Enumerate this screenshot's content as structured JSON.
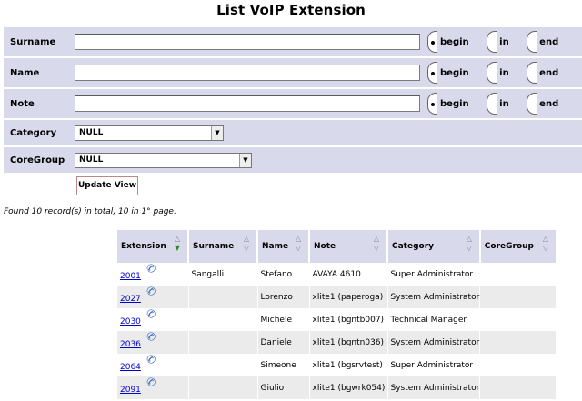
{
  "page": {
    "title": "List VoIP Extension"
  },
  "filters": {
    "surname": {
      "label": "Surname",
      "value": ""
    },
    "name": {
      "label": "Name",
      "value": ""
    },
    "note": {
      "label": "Note",
      "value": ""
    },
    "match_options": {
      "begin": "begin",
      "in": "in",
      "end": "end",
      "selected": "begin"
    },
    "category": {
      "label": "Category",
      "value": "NULL"
    },
    "coregroup": {
      "label": "CoreGroup",
      "value": "NULL"
    },
    "update_label": "Update View"
  },
  "status": {
    "found_text": "Found 10 record(s) in total, 10 in 1° page."
  },
  "table": {
    "columns": [
      "Extension",
      "Surname",
      "Name",
      "Note",
      "Category",
      "CoreGroup"
    ],
    "sorted_column": "Extension",
    "rows": [
      {
        "extension": "2001",
        "surname": "Sangalli",
        "name": "Stefano",
        "note": "AVAYA 4610",
        "category": "Super Administrator",
        "coregroup": ""
      },
      {
        "extension": "2027",
        "surname": "",
        "name": "Lorenzo",
        "note": "xlite1 (paperoga)",
        "category": "System Administrator",
        "coregroup": ""
      },
      {
        "extension": "2030",
        "surname": "",
        "name": "Michele",
        "note": "xlite1 (bgntb007)",
        "category": "Technical Manager",
        "coregroup": ""
      },
      {
        "extension": "2036",
        "surname": "",
        "name": "Daniele",
        "note": "xlite1 (bgntn036)",
        "category": "System Administrator",
        "coregroup": ""
      },
      {
        "extension": "2064",
        "surname": "",
        "name": "Simeone",
        "note": "xlite1 (bgsrvtest)",
        "category": "Super Administrator",
        "coregroup": ""
      },
      {
        "extension": "2091",
        "surname": "",
        "name": "Giulio",
        "note": "xlite1 (bgwrk054)",
        "category": "System Administrator",
        "coregroup": ""
      }
    ]
  },
  "icons": {
    "phone": "phone-icon",
    "sort": "sort-arrows-icon"
  },
  "colors": {
    "filter_bg": "#d9d9ec",
    "link": "#0000cc",
    "row_alt": "#ebebeb"
  }
}
